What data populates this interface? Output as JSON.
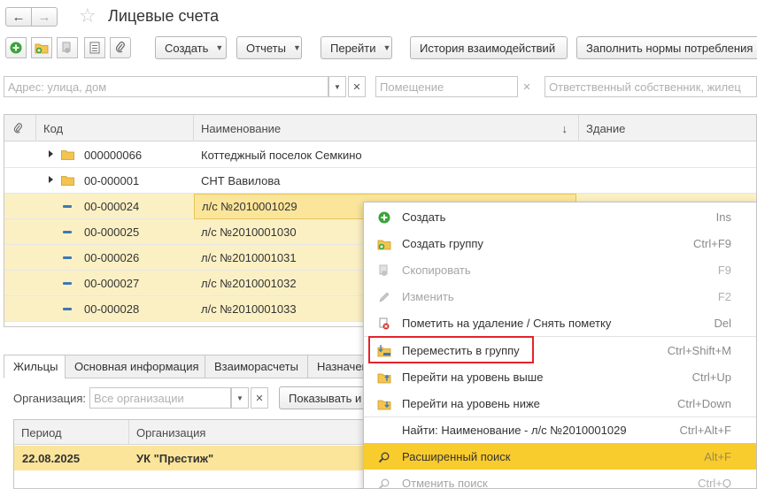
{
  "header": {
    "title": "Лицевые счета"
  },
  "toolbar": {
    "create": "Создать",
    "reports": "Отчеты",
    "goto": "Перейти",
    "history": "История взаимодействий",
    "fill_norms": "Заполнить нормы потребления"
  },
  "filters": {
    "address_placeholder": "Адрес: улица, дом",
    "room_placeholder": "Помещение",
    "owner_placeholder": "Ответственный собственник, жилец"
  },
  "grid": {
    "columns": {
      "code": "Код",
      "name": "Наименование",
      "building": "Здание",
      "sort_arrow": "↓"
    },
    "rows": [
      {
        "code": "000000066",
        "name": "Коттеджный поселок Семкино"
      },
      {
        "code": "00-000001",
        "name": "СНТ Вавилова"
      },
      {
        "code": "00-000024",
        "name": "л/с №2010001029"
      },
      {
        "code": "00-000025",
        "name": "л/с №2010001030"
      },
      {
        "code": "00-000026",
        "name": "л/с №2010001031"
      },
      {
        "code": "00-000027",
        "name": "л/с №2010001032"
      },
      {
        "code": "00-000028",
        "name": "л/с №2010001033"
      }
    ]
  },
  "tabs": {
    "residents": "Жильцы",
    "main_info": "Основная информация",
    "settlements": "Взаиморасчеты",
    "assign": "Назначен"
  },
  "org_filter": {
    "label": "Организация:",
    "placeholder": "Все организации",
    "show_btn": "Показывать и"
  },
  "sub_grid": {
    "columns": {
      "period": "Период",
      "org": "Организация"
    },
    "row": {
      "period": "22.08.2025",
      "org": "УК \"Престиж\""
    }
  },
  "context_menu": {
    "items": [
      {
        "label": "Создать",
        "shortcut": "Ins"
      },
      {
        "label": "Создать группу",
        "shortcut": "Ctrl+F9"
      },
      {
        "label": "Скопировать",
        "shortcut": "F9"
      },
      {
        "label": "Изменить",
        "shortcut": "F2"
      },
      {
        "label": "Пометить на удаление / Снять пометку",
        "shortcut": "Del"
      },
      {
        "label": "Переместить в группу",
        "shortcut": "Ctrl+Shift+M"
      },
      {
        "label": "Перейти на уровень выше",
        "shortcut": "Ctrl+Up"
      },
      {
        "label": "Перейти на уровень ниже",
        "shortcut": "Ctrl+Down"
      },
      {
        "label": "Найти: Наименование - л/с №2010001029",
        "shortcut": "Ctrl+Alt+F"
      },
      {
        "label": "Расширенный поиск",
        "shortcut": "Alt+F"
      },
      {
        "label": "Отменить поиск",
        "shortcut": "Ctrl+Q"
      }
    ]
  },
  "colors": {
    "accent_yellow": "#f9cc2d",
    "selection": "#fbf0c4",
    "highlight_box": "#e3242b"
  }
}
